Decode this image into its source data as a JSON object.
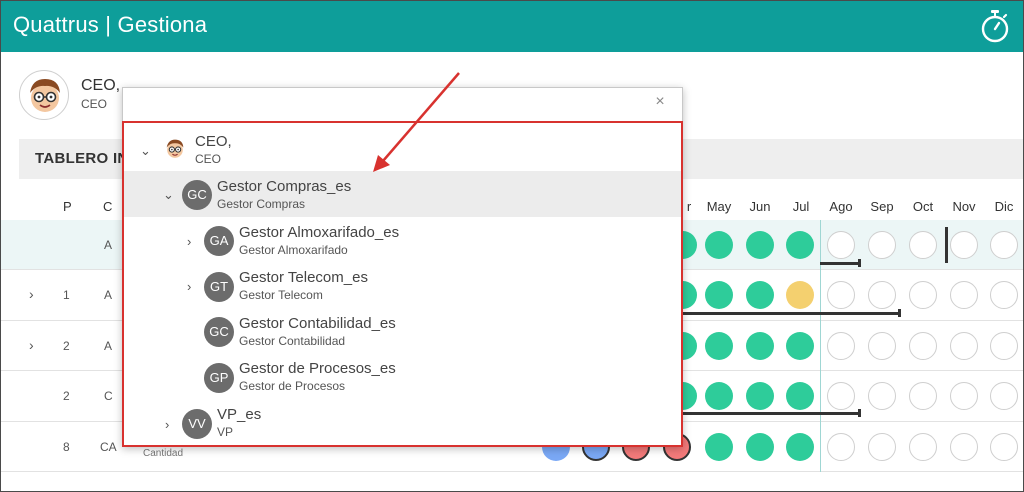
{
  "app": {
    "brand": "Quattrus | Gestiona"
  },
  "user": {
    "name": "CEO,",
    "role": "CEO"
  },
  "board": {
    "title": "TABLERO IN"
  },
  "table": {
    "col_p": "P",
    "col_c": "C",
    "months": [
      "r",
      "May",
      "Jun",
      "Jul",
      "Ago",
      "Sep",
      "Oct",
      "Nov",
      "Dic"
    ],
    "rows": [
      {
        "p": "",
        "c": "A"
      },
      {
        "p": "1",
        "c": "A"
      },
      {
        "p": "2",
        "c": "A"
      },
      {
        "p": "2",
        "c": "C"
      },
      {
        "p": "8",
        "c": "CA"
      }
    ],
    "last_row_label": "Cantidad"
  },
  "popup": {
    "close_label": "×",
    "tree": [
      {
        "initials": "",
        "name": "CEO,",
        "role": "CEO"
      },
      {
        "initials": "GC",
        "name": "Gestor Compras_es",
        "role": "Gestor Compras"
      },
      {
        "initials": "GA",
        "name": "Gestor Almoxarifado_es",
        "role": "Gestor Almoxarifado"
      },
      {
        "initials": "GT",
        "name": "Gestor Telecom_es",
        "role": "Gestor Telecom"
      },
      {
        "initials": "GC",
        "name": "Gestor Contabilidad_es",
        "role": "Gestor Contabilidad"
      },
      {
        "initials": "GP",
        "name": "Gestor de Procesos_es",
        "role": "Gestor de Procesos"
      },
      {
        "initials": "VV",
        "name": "VP_es",
        "role": "VP"
      }
    ]
  },
  "colors": {
    "brand": "#0e9e9a",
    "status_green": "#2ecc9a",
    "status_yellow": "#f4d06f",
    "status_blue": "#7aa8f5",
    "status_red": "#f47a7a",
    "annotation_red": "#d8322f"
  }
}
